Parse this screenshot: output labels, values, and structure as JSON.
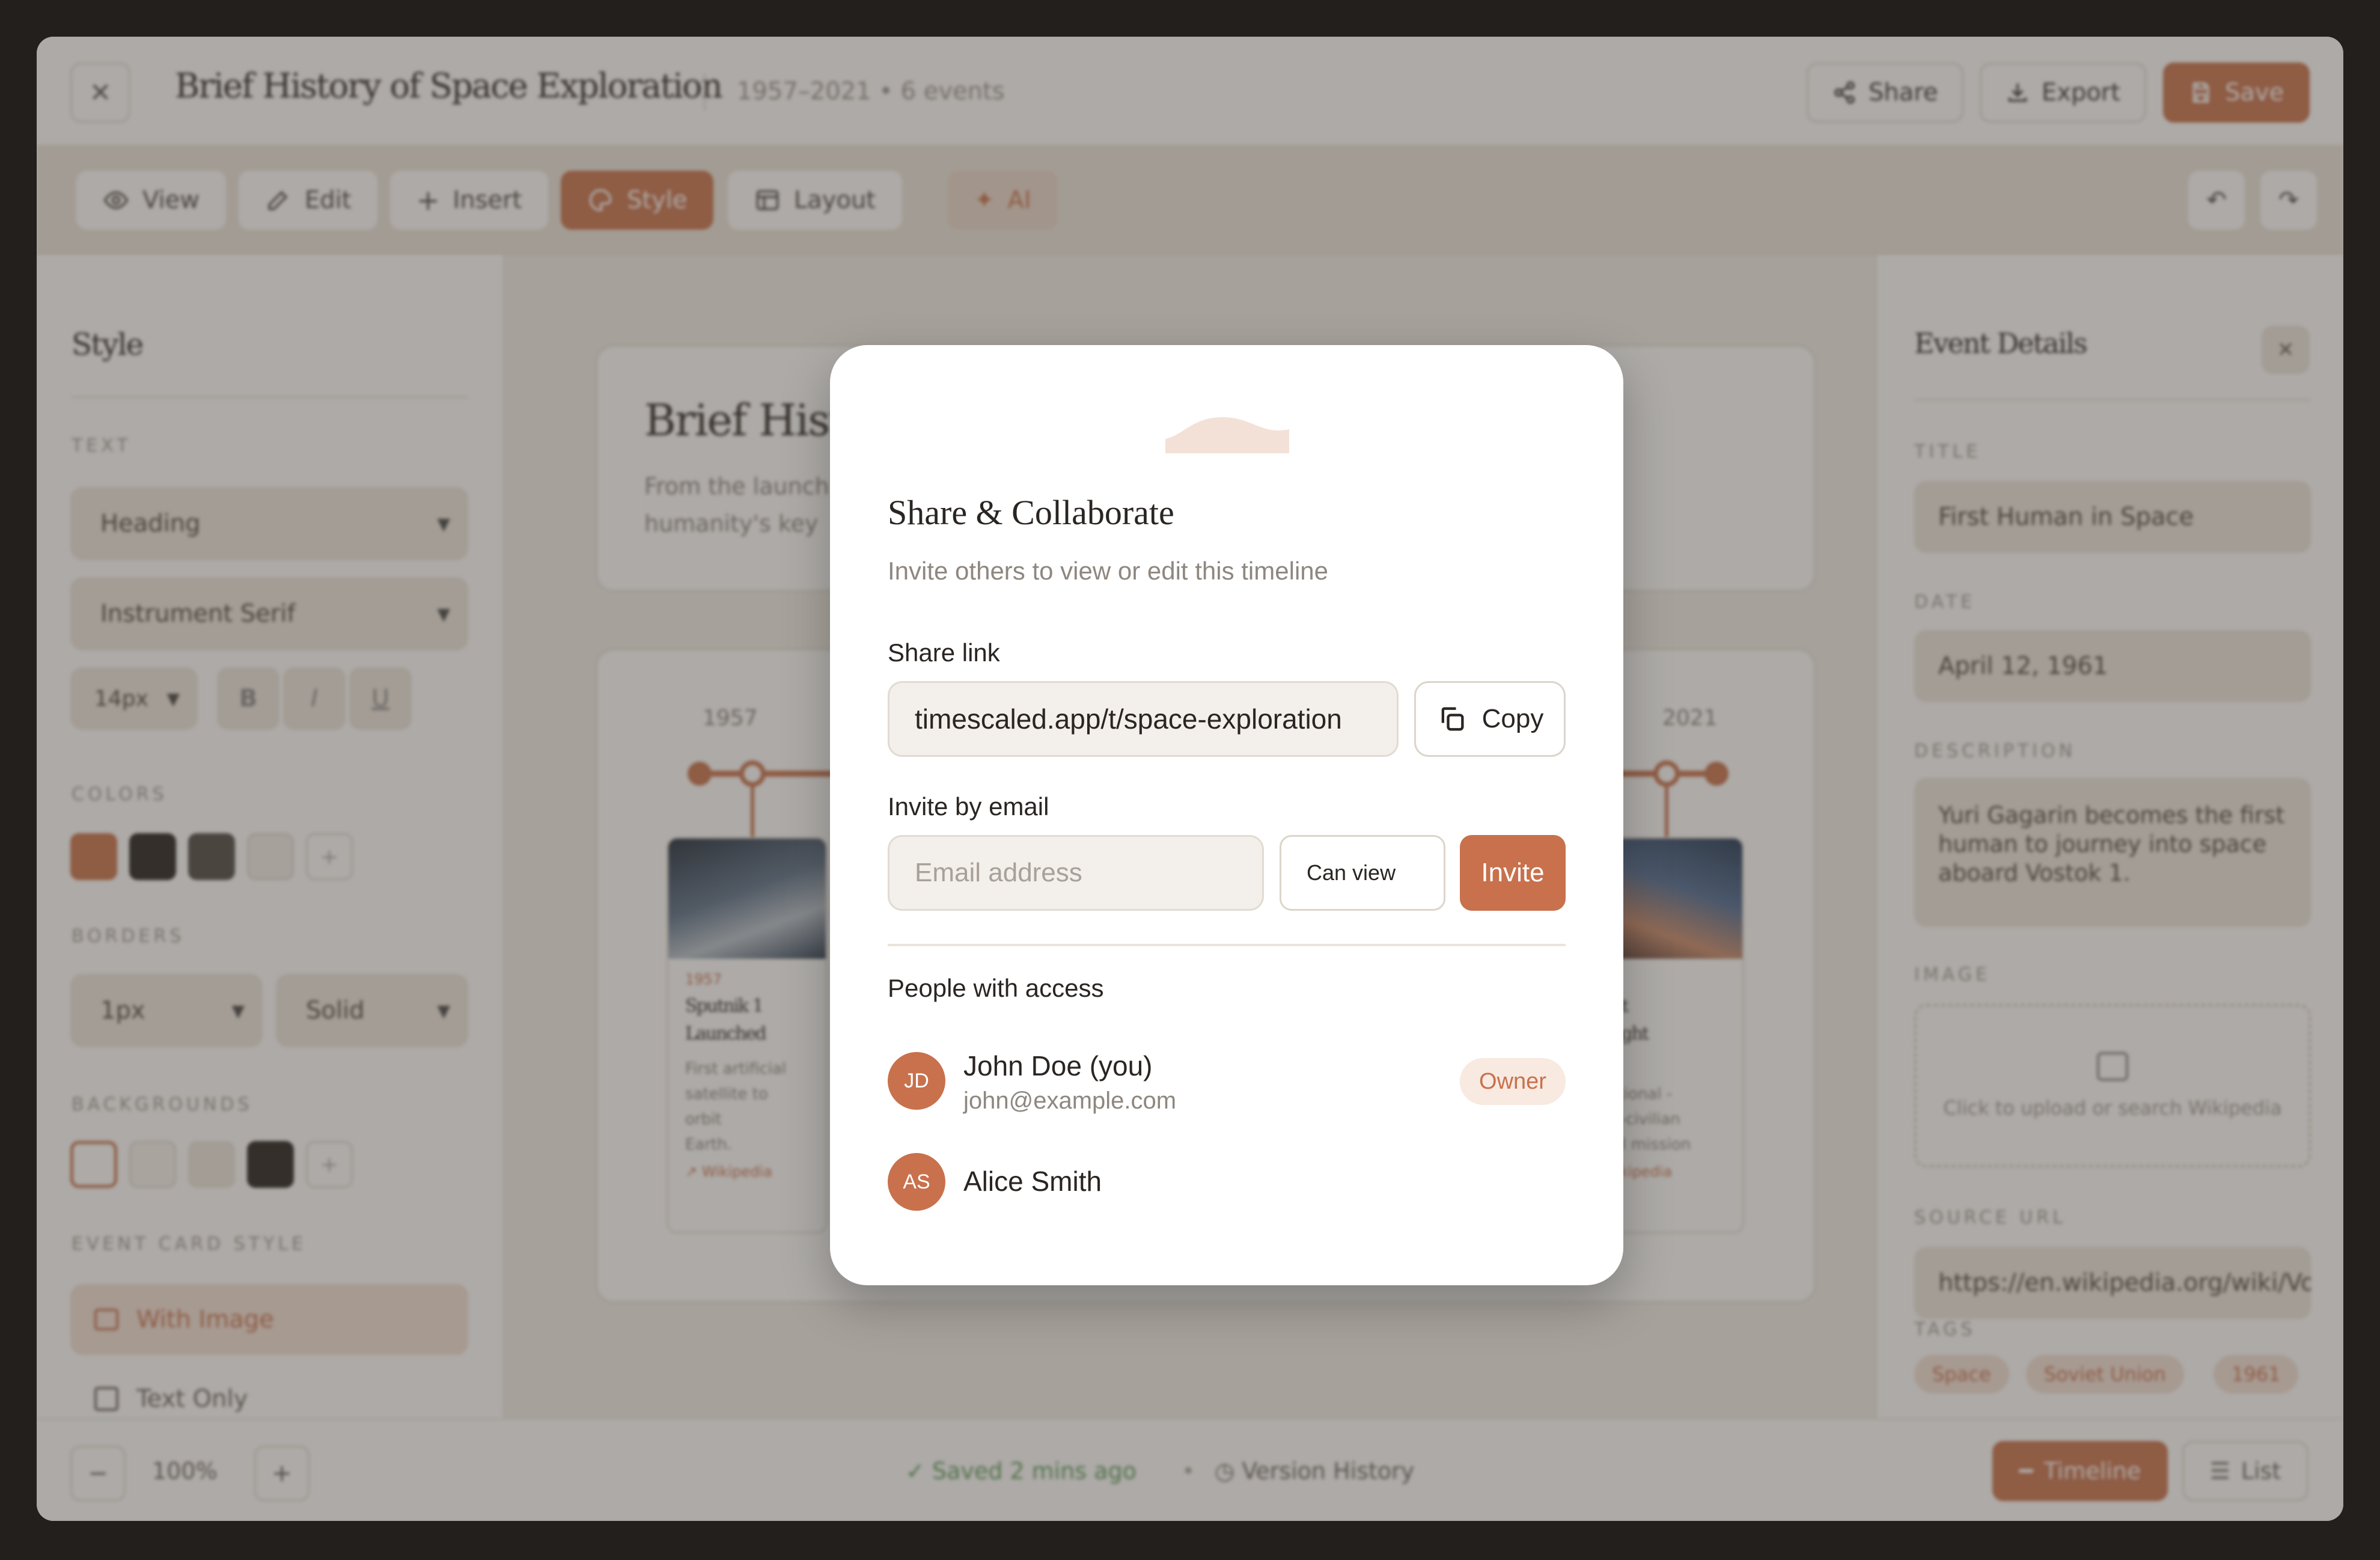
{
  "app": {
    "close_icon": "close-icon",
    "title": "Brief History of Space Exploration",
    "meta": "1957–2021  •  6 events",
    "share_label": "Share",
    "export_label": "Export",
    "save_label": "Save"
  },
  "toolbar": {
    "view_label": "View",
    "edit_label": "Edit",
    "insert_label": "Insert",
    "style_label": "Style",
    "layout_label": "Layout",
    "ai_label": "AI"
  },
  "style_panel": {
    "title": "Style",
    "text_label": "TEXT",
    "heading_select": "Heading",
    "font_select": "Instrument Serif",
    "size_select": "14px",
    "bold": "B",
    "italic": "I",
    "underline": "U",
    "colors_label": "COLORS",
    "colors": [
      "#c8714c",
      "#231f1c",
      "#4d4843",
      "#f2eee8"
    ],
    "borders_label": "BORDERS",
    "border_width": "1px",
    "border_style": "Solid",
    "backgrounds_label": "BACKGROUNDS",
    "backgrounds": [
      "#ffffff",
      "#f7f4ef",
      "#ede7de",
      "#231f1c"
    ],
    "event_card_label": "EVENT CARD STYLE",
    "with_image": "With Image",
    "text_only": "Text Only"
  },
  "canvas": {
    "title": "Brief History",
    "desc_line1": "From the launch",
    "desc_line2": "humanity's key",
    "year_start": "1957",
    "year_end": "2021",
    "event1": {
      "year": "1957",
      "title_l1": "Sputnik 1",
      "title_l2": "Launched",
      "desc_l1": "First artificial",
      "desc_l2": "satellite to orbit",
      "desc_l3": "Earth.",
      "link": "Wikipedia"
    },
    "event2": {
      "title_l1": "nat",
      "title_l2": "dlight",
      "desc_l1": "ll",
      "desc_l2": "rational -",
      "desc_l3": "all-civilian",
      "desc_l4": "ital mission",
      "link": "Wikipedia"
    }
  },
  "details_panel": {
    "title": "Event Details",
    "title_label": "TITLE",
    "title_value": "First Human in Space",
    "date_label": "DATE",
    "date_value": "April 12, 1961",
    "description_label": "DESCRIPTION",
    "description_value": "Yuri Gagarin becomes the first human to journey into space aboard Vostok 1.",
    "image_label": "IMAGE",
    "image_hint": "Click to upload or search Wikipedia",
    "source_label": "SOURCE URL",
    "source_value": "https://en.wikipedia.org/wiki/Vost",
    "tags_label": "TAGS",
    "tags": [
      "Space",
      "Soviet Union",
      "1961"
    ]
  },
  "footer": {
    "zoom_out": "−",
    "zoom": "100%",
    "zoom_in": "+",
    "saved": "Saved 2 mins ago",
    "version_history": "Version History",
    "timeline": "Timeline",
    "list": "List"
  },
  "modal": {
    "title": "Share & Collaborate",
    "subtitle": "Invite others to view or edit this timeline",
    "share_link_label": "Share link",
    "share_link_value": "timescaled.app/t/space-exploration",
    "copy_label": "Copy",
    "invite_label_heading": "Invite by email",
    "email_placeholder": "Email address",
    "permission": "Can view",
    "invite_button": "Invite",
    "people_heading": "People with access",
    "people": [
      {
        "initials": "JD",
        "name": "John Doe (you)",
        "email": "john@example.com",
        "role": "Owner"
      },
      {
        "initials": "AS",
        "name": "Alice Smith"
      }
    ]
  },
  "colors": {
    "accent": "#c8714c",
    "dark": "#231f1c"
  }
}
